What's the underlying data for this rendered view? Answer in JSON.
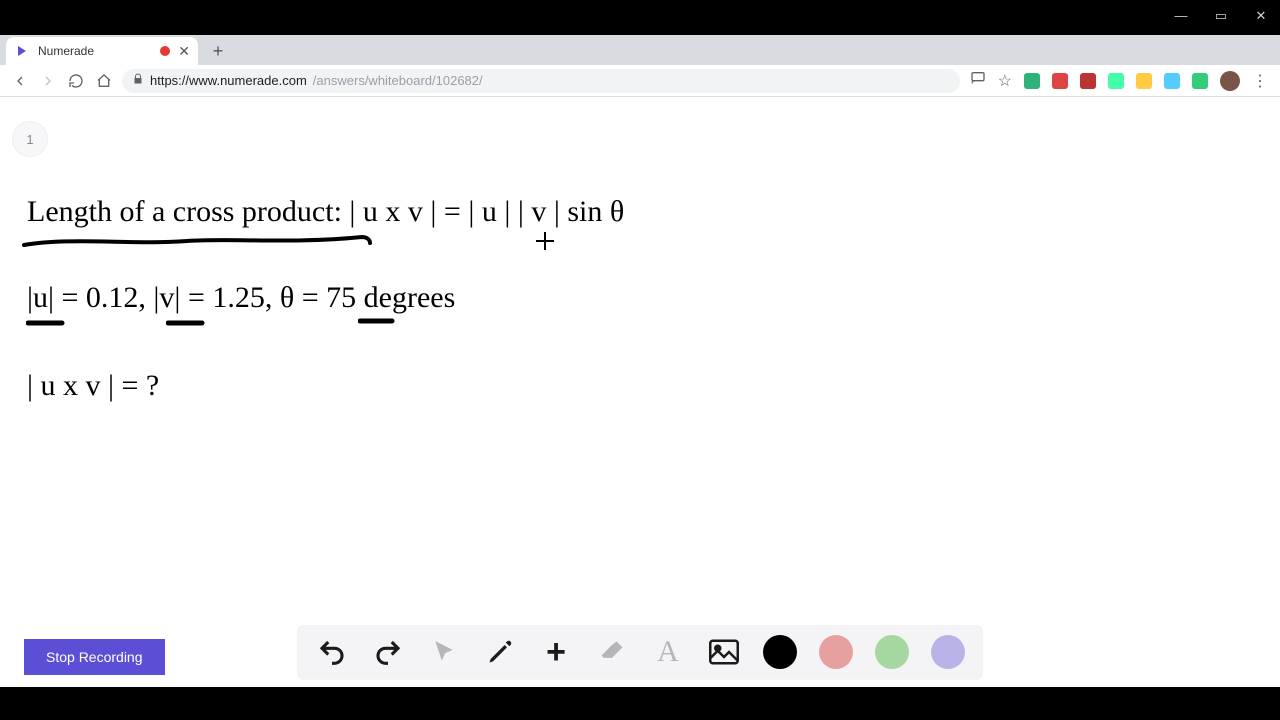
{
  "window": {
    "minimize": "—",
    "maximize": "▭",
    "close": "✕"
  },
  "tab": {
    "title": "Numerade",
    "close_glyph": "✕"
  },
  "addressbar": {
    "scheme_icon": "lock",
    "host": "https://www.numerade.com",
    "path": "/answers/whiteboard/102682/"
  },
  "slide": {
    "label": "1"
  },
  "whiteboard": {
    "line1": "Length of a cross product: | u x v | = | u | | v | sin θ",
    "line2": "|u| = 0.12, |v| = 1.25, θ = 75 degrees",
    "line3": "| u x v | = ?"
  },
  "buttons": {
    "stop_recording": "Stop Recording"
  },
  "toolbar": {
    "undo": "undo",
    "redo": "redo",
    "pointer": "pointer",
    "pencil": "pencil",
    "plus": "plus",
    "eraser": "eraser",
    "text": "text",
    "image": "image"
  },
  "colors": {
    "black": "#000000",
    "red": "#e7a0a0",
    "green": "#a7d7a0",
    "purple": "#b9b4e8"
  }
}
